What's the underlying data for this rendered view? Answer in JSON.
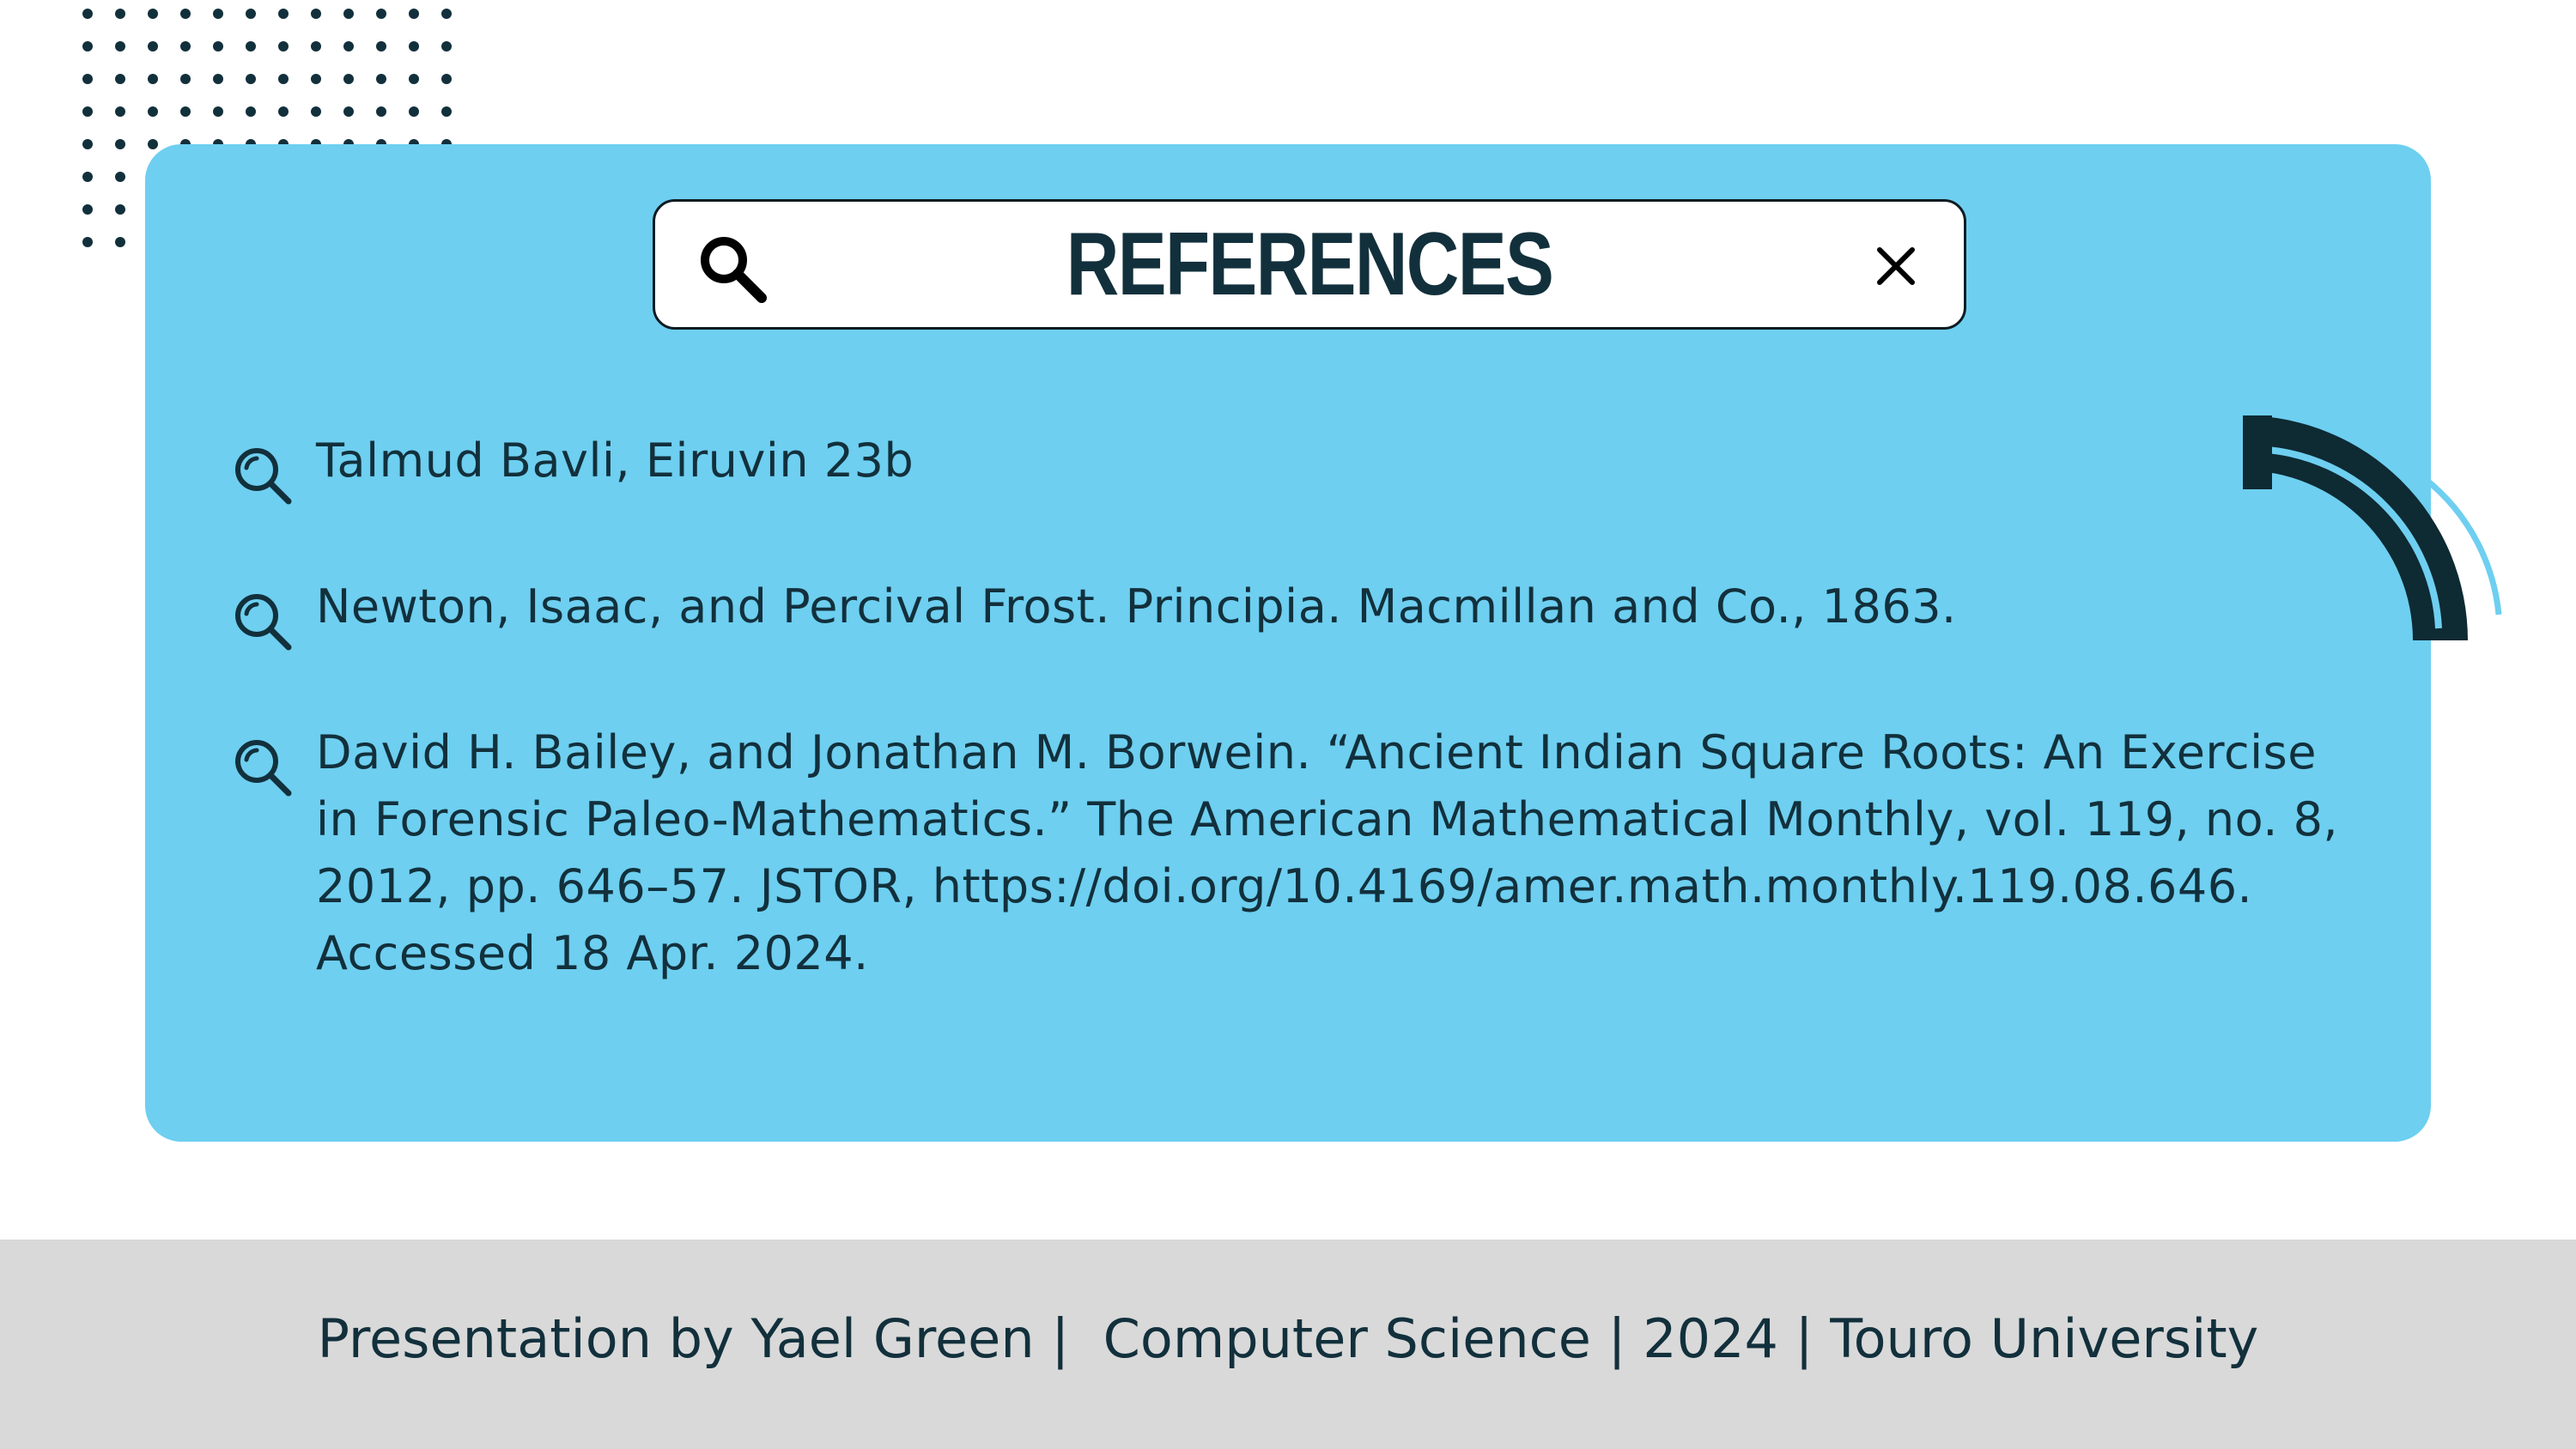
{
  "header": {
    "title": "REFERENCES",
    "search_icon": "search-icon",
    "close_icon": "close-icon"
  },
  "references": [
    {
      "icon": "magnifier-icon",
      "text": "Talmud Bavli, Eiruvin 23b"
    },
    {
      "icon": "magnifier-icon",
      "text": "Newton, Isaac, and Percival Frost. Principia. Macmillan and Co., 1863."
    },
    {
      "icon": "magnifier-icon",
      "text": "David H. Bailey, and Jonathan M. Borwein. “Ancient Indian Square Roots: An Exercise in Forensic Paleo-Mathematics.” The American Mathematical Monthly, vol. 119, no. 8, 2012, pp. 646–57. JSTOR, https://doi.org/10.4169/amer.math.monthly.119.08.646. Accessed 18 Apr. 2024."
    }
  ],
  "footer": {
    "text": "Presentation by Yael Green |  Computer Science | 2024 | Touro University"
  },
  "colors": {
    "card": "#6ecff0",
    "ink": "#12303c",
    "dark": "#0e2a33",
    "footer": "#d9d9d9",
    "background": "#ffffff"
  }
}
